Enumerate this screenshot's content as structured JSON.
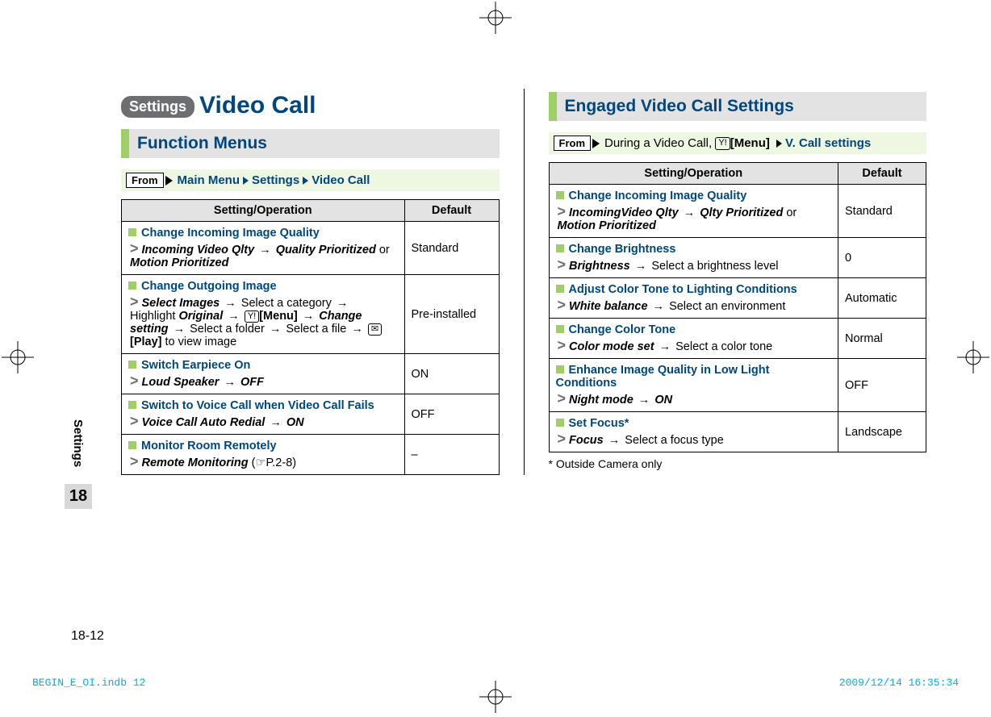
{
  "header": {
    "pill": "Settings",
    "title": "Video Call"
  },
  "left": {
    "h2": "Function Menus",
    "from_label": "From",
    "crumbs": [
      "Main Menu",
      "Settings",
      "Video Call"
    ],
    "th_setting": "Setting/Operation",
    "th_default": "Default",
    "rows": [
      {
        "title": "Change Incoming Image Quality",
        "path_html": "<span class='em'>Incoming Video Qlty</span> <span class='arrow'>→</span> <span class='em'>Quality Prioritized</span> or <span class='em'>Motion Prioritized</span>",
        "default": "Standard"
      },
      {
        "title": "Change Outgoing Image",
        "path_html": "<span class='em'>Select Images</span> <span class='arrow'>→</span> Select a category <span class='arrow'>→</span> Highlight <span class='em'>Original</span> <span class='arrow'>→</span> <span class='keybox'>Y!</span><b>[Menu]</b> <span class='arrow'>→</span> <span class='em'>Change setting</span> <span class='arrow'>→</span> Select a folder <span class='arrow'>→</span> Select a file <span class='arrow'>→</span> <span class='keybox'>✉</span><b>[Play]</b> to view image",
        "default": "Pre-installed"
      },
      {
        "title": "Switch Earpiece On",
        "path_html": "<span class='em'>Loud Speaker</span> <span class='arrow'>→</span> <span class='em'>OFF</span>",
        "default": "ON"
      },
      {
        "title": "Switch to Voice Call when Video Call Fails",
        "path_html": "<span class='em'>Voice Call Auto Redial</span> <span class='arrow'>→</span> <span class='em'>ON</span>",
        "default": "OFF"
      },
      {
        "title": "Monitor Room Remotely",
        "path_html": "<span class='em'>Remote Monitoring</span> (☞P.2-8)",
        "default": "–"
      }
    ]
  },
  "right": {
    "h2": "Engaged Video Call Settings",
    "from_label": "From",
    "from_text_pre": "During a Video Call, ",
    "from_menu": "[Menu]",
    "from_crumb": "V. Call settings",
    "th_setting": "Setting/Operation",
    "th_default": "Default",
    "rows": [
      {
        "title": "Change Incoming Image Quality",
        "path_html": "<span class='em'>IncomingVideo Qlty</span> <span class='arrow'>→</span> <span class='em'>Qlty Prioritized</span> or <span class='em'>Motion Prioritized</span>",
        "default": "Standard"
      },
      {
        "title": "Change Brightness",
        "path_html": "<span class='em'>Brightness</span> <span class='arrow'>→</span> Select a brightness level",
        "default": "0"
      },
      {
        "title": "Adjust Color Tone to Lighting Conditions",
        "path_html": "<span class='em'>White balance</span> <span class='arrow'>→</span> Select an environment",
        "default": "Automatic"
      },
      {
        "title": "Change Color Tone",
        "path_html": "<span class='em'>Color mode set</span> <span class='arrow'>→</span> Select a color tone",
        "default": "Normal"
      },
      {
        "title": "Enhance Image Quality in Low Light Conditions",
        "path_html": "<span class='em'>Night mode</span> <span class='arrow'>→</span> <span class='em'>ON</span>",
        "default": "OFF"
      },
      {
        "title": "Set Focus*",
        "path_html": "<span class='em'>Focus</span> <span class='arrow'>→</span> Select a focus type",
        "default": "Landscape"
      }
    ],
    "footnote": "* Outside Camera only"
  },
  "side": {
    "label": "Settings",
    "chapter": "18"
  },
  "page_number": "18-12",
  "print": {
    "left": "BEGIN_E_OI.indb   12",
    "right": "2009/12/14   16:35:34"
  }
}
